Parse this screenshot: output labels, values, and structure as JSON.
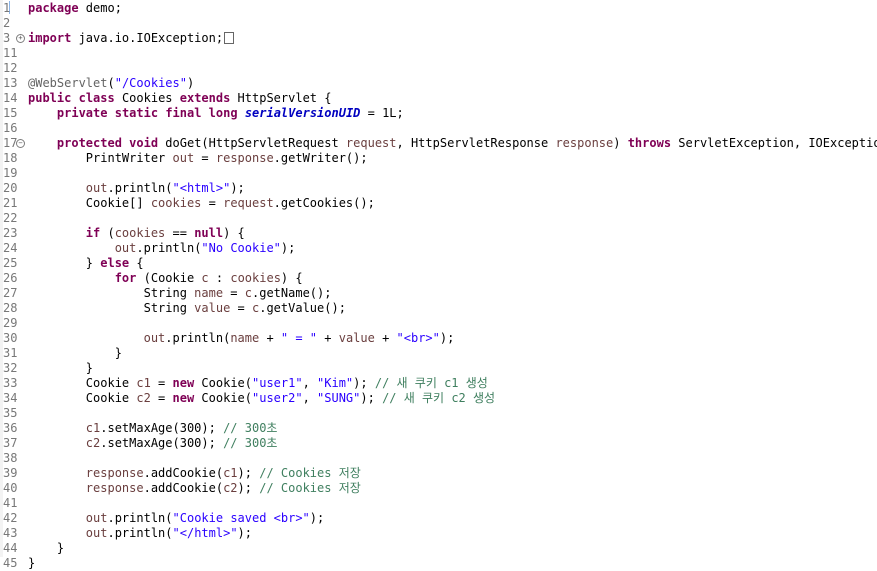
{
  "editor": {
    "lines": [
      {
        "n": "1",
        "tokens": [
          {
            "t": "package",
            "c": "kw"
          },
          {
            "t": " demo;"
          }
        ]
      },
      {
        "n": "2",
        "tokens": []
      },
      {
        "n": "3",
        "fold": "+",
        "tokens": [
          {
            "t": "import",
            "c": "kw"
          },
          {
            "t": " java.io.IOException;"
          }
        ],
        "collapsed": true
      },
      {
        "n": "11",
        "tokens": []
      },
      {
        "n": "12",
        "tokens": []
      },
      {
        "n": "13",
        "tokens": [
          {
            "t": "@WebServlet",
            "c": "ann"
          },
          {
            "t": "("
          },
          {
            "t": "\"/Cookies\"",
            "c": "str"
          },
          {
            "t": ")"
          }
        ]
      },
      {
        "n": "14",
        "tokens": [
          {
            "t": "public",
            "c": "kw"
          },
          {
            "t": " "
          },
          {
            "t": "class",
            "c": "kw"
          },
          {
            "t": " Cookies "
          },
          {
            "t": "extends",
            "c": "kw"
          },
          {
            "t": " HttpServlet {"
          }
        ]
      },
      {
        "n": "15",
        "tokens": [
          {
            "t": "    "
          },
          {
            "t": "private",
            "c": "kw"
          },
          {
            "t": " "
          },
          {
            "t": "static",
            "c": "kw"
          },
          {
            "t": " "
          },
          {
            "t": "final",
            "c": "kw"
          },
          {
            "t": " "
          },
          {
            "t": "long",
            "c": "kw"
          },
          {
            "t": " "
          },
          {
            "t": "serialVersionUID",
            "c": "fld"
          },
          {
            "t": " = 1L;"
          }
        ]
      },
      {
        "n": "16",
        "tokens": []
      },
      {
        "n": "17",
        "fold": "−",
        "tokens": [
          {
            "t": "    "
          },
          {
            "t": "protected",
            "c": "kw"
          },
          {
            "t": " "
          },
          {
            "t": "void",
            "c": "kw"
          },
          {
            "t": " doGet(HttpServletRequest "
          },
          {
            "t": "request",
            "c": "var"
          },
          {
            "t": ", HttpServletResponse "
          },
          {
            "t": "response",
            "c": "var"
          },
          {
            "t": ") "
          },
          {
            "t": "throws",
            "c": "kw"
          },
          {
            "t": " ServletException, IOException {"
          }
        ]
      },
      {
        "n": "18",
        "tokens": [
          {
            "t": "        PrintWriter "
          },
          {
            "t": "out",
            "c": "var"
          },
          {
            "t": " = "
          },
          {
            "t": "response",
            "c": "var"
          },
          {
            "t": ".getWriter();"
          }
        ]
      },
      {
        "n": "19",
        "tokens": []
      },
      {
        "n": "20",
        "tokens": [
          {
            "t": "        "
          },
          {
            "t": "out",
            "c": "var"
          },
          {
            "t": ".println("
          },
          {
            "t": "\"<html>\"",
            "c": "str"
          },
          {
            "t": ");"
          }
        ]
      },
      {
        "n": "21",
        "tokens": [
          {
            "t": "        Cookie[] "
          },
          {
            "t": "cookies",
            "c": "var"
          },
          {
            "t": " = "
          },
          {
            "t": "request",
            "c": "var"
          },
          {
            "t": ".getCookies();"
          }
        ]
      },
      {
        "n": "22",
        "tokens": []
      },
      {
        "n": "23",
        "tokens": [
          {
            "t": "        "
          },
          {
            "t": "if",
            "c": "kw"
          },
          {
            "t": " ("
          },
          {
            "t": "cookies",
            "c": "var"
          },
          {
            "t": " == "
          },
          {
            "t": "null",
            "c": "kw"
          },
          {
            "t": ") {"
          }
        ]
      },
      {
        "n": "24",
        "tokens": [
          {
            "t": "            "
          },
          {
            "t": "out",
            "c": "var"
          },
          {
            "t": ".println("
          },
          {
            "t": "\"No Cookie\"",
            "c": "str"
          },
          {
            "t": ");"
          }
        ]
      },
      {
        "n": "25",
        "tokens": [
          {
            "t": "        } "
          },
          {
            "t": "else",
            "c": "kw"
          },
          {
            "t": " {"
          }
        ]
      },
      {
        "n": "26",
        "tokens": [
          {
            "t": "            "
          },
          {
            "t": "for",
            "c": "kw"
          },
          {
            "t": " (Cookie "
          },
          {
            "t": "c",
            "c": "var"
          },
          {
            "t": " : "
          },
          {
            "t": "cookies",
            "c": "var"
          },
          {
            "t": ") {"
          }
        ]
      },
      {
        "n": "27",
        "tokens": [
          {
            "t": "                String "
          },
          {
            "t": "name",
            "c": "var"
          },
          {
            "t": " = "
          },
          {
            "t": "c",
            "c": "var"
          },
          {
            "t": ".getName();"
          }
        ]
      },
      {
        "n": "28",
        "tokens": [
          {
            "t": "                String "
          },
          {
            "t": "value",
            "c": "var"
          },
          {
            "t": " = "
          },
          {
            "t": "c",
            "c": "var"
          },
          {
            "t": ".getValue();"
          }
        ]
      },
      {
        "n": "29",
        "tokens": []
      },
      {
        "n": "30",
        "tokens": [
          {
            "t": "                "
          },
          {
            "t": "out",
            "c": "var"
          },
          {
            "t": ".println("
          },
          {
            "t": "name",
            "c": "var"
          },
          {
            "t": " + "
          },
          {
            "t": "\" = \"",
            "c": "str"
          },
          {
            "t": " + "
          },
          {
            "t": "value",
            "c": "var"
          },
          {
            "t": " + "
          },
          {
            "t": "\"<br>\"",
            "c": "str"
          },
          {
            "t": ");"
          }
        ]
      },
      {
        "n": "31",
        "tokens": [
          {
            "t": "            }"
          }
        ]
      },
      {
        "n": "32",
        "tokens": [
          {
            "t": "        }"
          }
        ]
      },
      {
        "n": "33",
        "tokens": [
          {
            "t": "        Cookie "
          },
          {
            "t": "c1",
            "c": "var"
          },
          {
            "t": " = "
          },
          {
            "t": "new",
            "c": "kw"
          },
          {
            "t": " Cookie("
          },
          {
            "t": "\"user1\"",
            "c": "str"
          },
          {
            "t": ", "
          },
          {
            "t": "\"Kim\"",
            "c": "str"
          },
          {
            "t": "); "
          },
          {
            "t": "// 새 쿠키 c1 생성",
            "c": "cmt"
          }
        ]
      },
      {
        "n": "34",
        "tokens": [
          {
            "t": "        Cookie "
          },
          {
            "t": "c2",
            "c": "var"
          },
          {
            "t": " = "
          },
          {
            "t": "new",
            "c": "kw"
          },
          {
            "t": " Cookie("
          },
          {
            "t": "\"user2\"",
            "c": "str"
          },
          {
            "t": ", "
          },
          {
            "t": "\"SUNG\"",
            "c": "str"
          },
          {
            "t": "); "
          },
          {
            "t": "// 새 쿠키 c2 생성",
            "c": "cmt"
          }
        ]
      },
      {
        "n": "35",
        "tokens": []
      },
      {
        "n": "36",
        "tokens": [
          {
            "t": "        "
          },
          {
            "t": "c1",
            "c": "var"
          },
          {
            "t": ".setMaxAge(300); "
          },
          {
            "t": "// 300초",
            "c": "cmt"
          }
        ]
      },
      {
        "n": "37",
        "tokens": [
          {
            "t": "        "
          },
          {
            "t": "c2",
            "c": "var"
          },
          {
            "t": ".setMaxAge(300); "
          },
          {
            "t": "// 300초",
            "c": "cmt"
          }
        ]
      },
      {
        "n": "38",
        "tokens": []
      },
      {
        "n": "39",
        "tokens": [
          {
            "t": "        "
          },
          {
            "t": "response",
            "c": "var"
          },
          {
            "t": ".addCookie("
          },
          {
            "t": "c1",
            "c": "var"
          },
          {
            "t": "); "
          },
          {
            "t": "// Cookies 저장",
            "c": "cmt"
          }
        ]
      },
      {
        "n": "40",
        "tokens": [
          {
            "t": "        "
          },
          {
            "t": "response",
            "c": "var"
          },
          {
            "t": ".addCookie("
          },
          {
            "t": "c2",
            "c": "var"
          },
          {
            "t": "); "
          },
          {
            "t": "// Cookies 저장",
            "c": "cmt"
          }
        ]
      },
      {
        "n": "41",
        "tokens": []
      },
      {
        "n": "42",
        "tokens": [
          {
            "t": "        "
          },
          {
            "t": "out",
            "c": "var"
          },
          {
            "t": ".println("
          },
          {
            "t": "\"Cookie saved <br>\"",
            "c": "str"
          },
          {
            "t": ");"
          }
        ]
      },
      {
        "n": "43",
        "tokens": [
          {
            "t": "        "
          },
          {
            "t": "out",
            "c": "var"
          },
          {
            "t": ".println("
          },
          {
            "t": "\"</html>\"",
            "c": "str"
          },
          {
            "t": ");"
          }
        ]
      },
      {
        "n": "44",
        "tokens": [
          {
            "t": "    }"
          }
        ]
      },
      {
        "n": "45",
        "tokens": [
          {
            "t": "}"
          }
        ]
      }
    ]
  }
}
